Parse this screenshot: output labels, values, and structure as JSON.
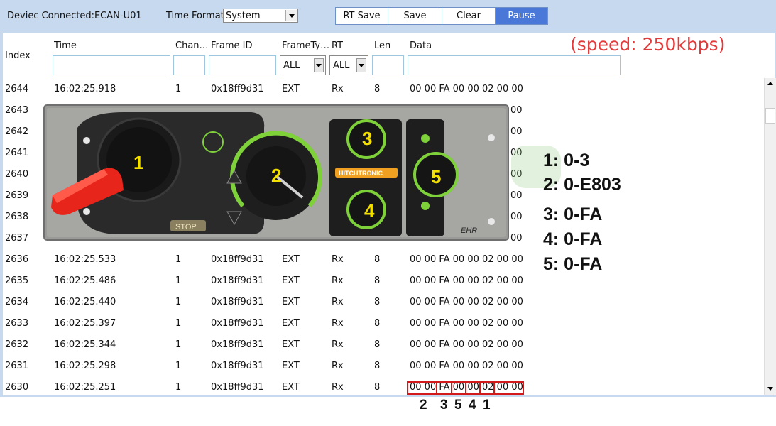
{
  "toolbar": {
    "device_label": "Deviec Connected:ECAN-U01",
    "time_format_label": "Time Format:",
    "time_format_value": "System",
    "buttons": [
      "RT Save",
      "Save",
      "Clear",
      "Pause"
    ],
    "active_button": "Pause"
  },
  "table": {
    "headers": [
      "Index",
      "Time",
      "Chan…",
      "Frame ID",
      "FrameTy…",
      "RT",
      "Len",
      "Data"
    ],
    "filters": {
      "frame_type": "ALL",
      "rt": "ALL"
    },
    "rows": [
      {
        "index": "2644",
        "time": "16:02:25.918",
        "chan": "1",
        "frame_id": "0x18ff9d31",
        "frame_type": "EXT",
        "rt": "Rx",
        "len": "8",
        "data": "00 00 FA 00 00 02 00 00"
      },
      {
        "index": "2643",
        "data_tail": "00"
      },
      {
        "index": "2642",
        "data_tail": "00"
      },
      {
        "index": "2641",
        "data_tail": "00"
      },
      {
        "index": "2640",
        "data_tail": "00"
      },
      {
        "index": "2639",
        "data_tail": "00"
      },
      {
        "index": "2638",
        "data_tail": "00"
      },
      {
        "index": "2637",
        "data_tail": "00"
      },
      {
        "index": "2636",
        "time": "16:02:25.533",
        "chan": "1",
        "frame_id": "0x18ff9d31",
        "frame_type": "EXT",
        "rt": "Rx",
        "len": "8",
        "data": "00 00 FA 00 00 02 00 00"
      },
      {
        "index": "2635",
        "time": "16:02:25.486",
        "chan": "1",
        "frame_id": "0x18ff9d31",
        "frame_type": "EXT",
        "rt": "Rx",
        "len": "8",
        "data": "00 00 FA 00 00 02 00 00"
      },
      {
        "index": "2634",
        "time": "16:02:25.440",
        "chan": "1",
        "frame_id": "0x18ff9d31",
        "frame_type": "EXT",
        "rt": "Rx",
        "len": "8",
        "data": "00 00 FA 00 00 02 00 00"
      },
      {
        "index": "2633",
        "time": "16:02:25.397",
        "chan": "1",
        "frame_id": "0x18ff9d31",
        "frame_type": "EXT",
        "rt": "Rx",
        "len": "8",
        "data": "00 00 FA 00 00 02 00 00"
      },
      {
        "index": "2632",
        "time": "16:02:25.344",
        "chan": "1",
        "frame_id": "0x18ff9d31",
        "frame_type": "EXT",
        "rt": "Rx",
        "len": "8",
        "data": "00 00 FA 00 00 02 00 00"
      },
      {
        "index": "2631",
        "time": "16:02:25.298",
        "chan": "1",
        "frame_id": "0x18ff9d31",
        "frame_type": "EXT",
        "rt": "Rx",
        "len": "8",
        "data": "00 00 FA 00 00 02 00 00"
      },
      {
        "index": "2630",
        "time": "16:02:25.251",
        "chan": "1",
        "frame_id": "0x18ff9d31",
        "frame_type": "EXT",
        "rt": "Rx",
        "len": "8",
        "data": "00 00 FA 00 00 02 00 00"
      }
    ]
  },
  "overlay": {
    "speed": "(speed: 250kbps)",
    "ranges": [
      "1: 0-3",
      "2: 0-E803",
      "3: 0-FA",
      "4: 0-FA",
      "5: 0-FA"
    ],
    "byte_groups": [
      "00 00",
      "FA",
      "00",
      "00",
      "02",
      "00 00"
    ],
    "byte_labels": [
      "2",
      "3",
      "5",
      "4",
      "1"
    ],
    "panel": {
      "knob_numbers": [
        "1",
        "2",
        "3",
        "4",
        "5"
      ],
      "stop_label": "STOP",
      "hitchtronic_label": "HITCHTRONIC",
      "ehr_label": "EHR"
    },
    "colors": {
      "highlight_red": "#d21a1a",
      "speed_red": "#e23a3a",
      "panel_green": "#7fd13a",
      "knob_number_yellow": "#f4e000",
      "pause_blue": "#4a78d8"
    }
  }
}
